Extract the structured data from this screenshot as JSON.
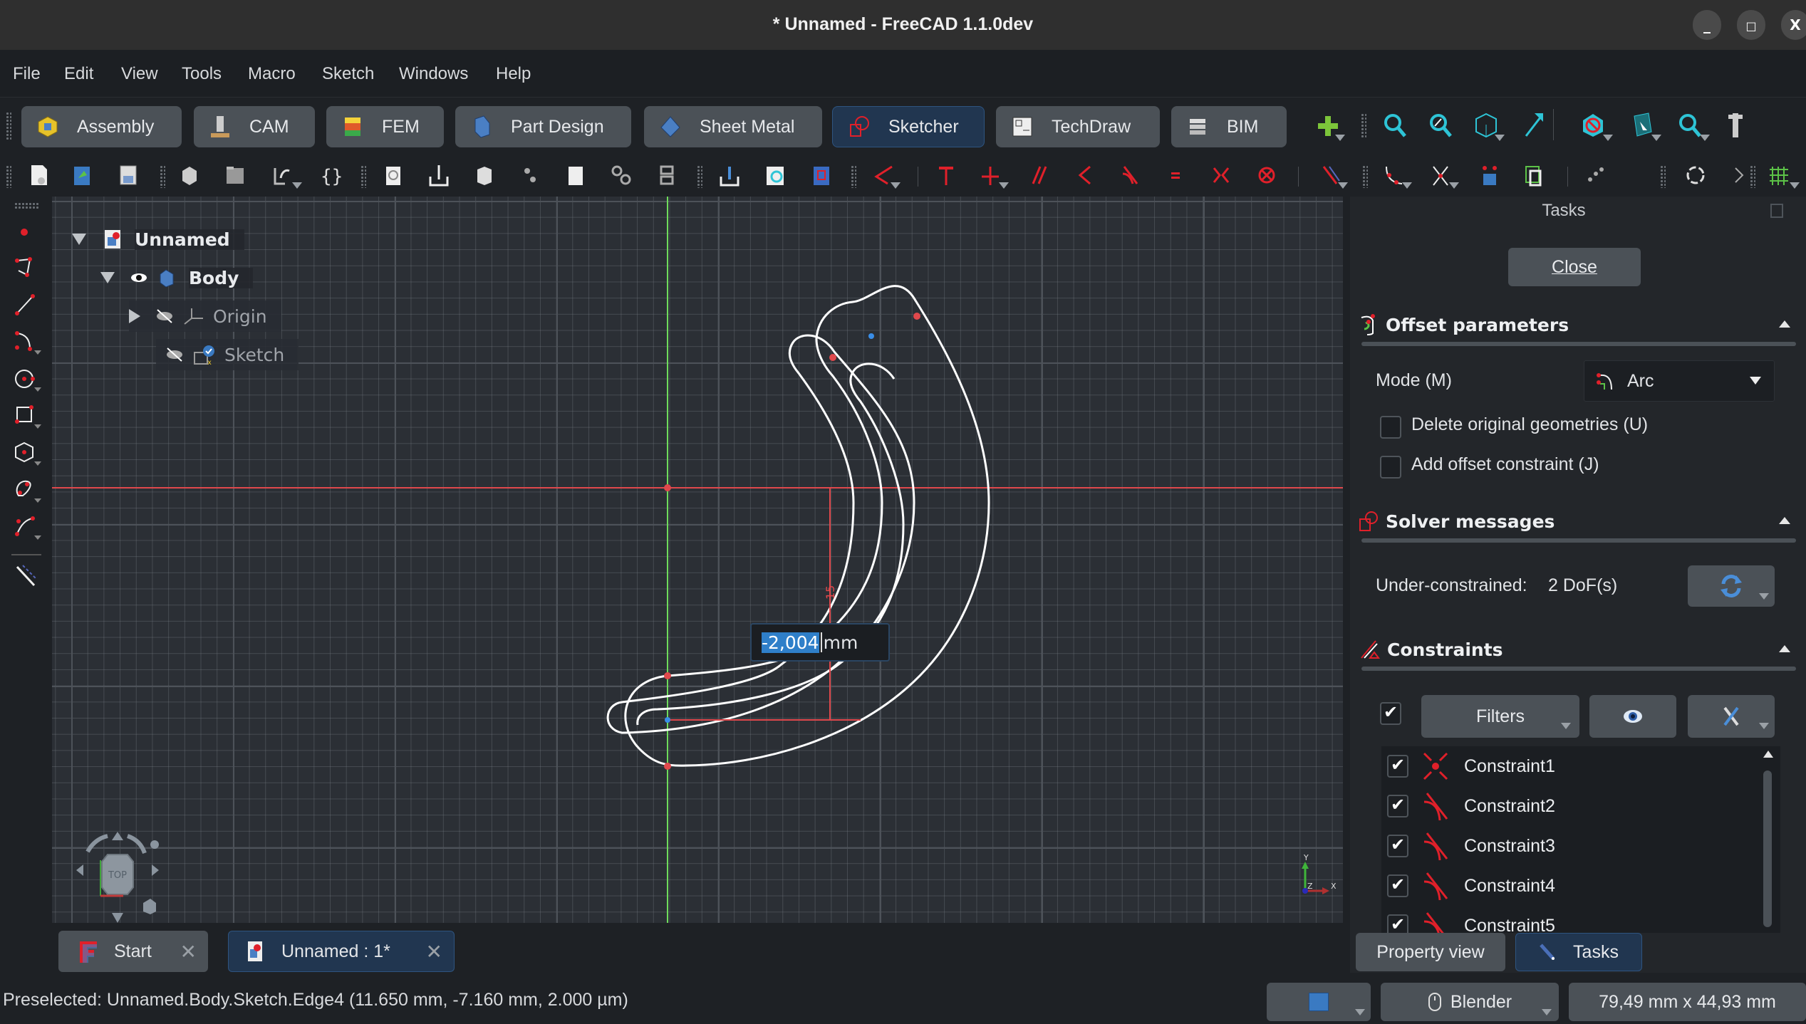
{
  "window": {
    "title": "* Unnamed - FreeCAD 1.1.0dev",
    "controls": {
      "minimize": "_",
      "maximize": "□",
      "close": "X"
    }
  },
  "menu": [
    {
      "label": "File",
      "mnemonic": "F"
    },
    {
      "label": "Edit",
      "mnemonic": "E"
    },
    {
      "label": "View",
      "mnemonic": "V"
    },
    {
      "label": "Tools",
      "mnemonic": "T"
    },
    {
      "label": "Macro",
      "mnemonic": "M"
    },
    {
      "label": "Sketch",
      "mnemonic": "S"
    },
    {
      "label": "Windows",
      "mnemonic": "W"
    },
    {
      "label": "Help",
      "mnemonic": "H"
    }
  ],
  "workbenches": [
    {
      "label": "Assembly",
      "icon": "assembly-icon",
      "active": false
    },
    {
      "label": "CAM",
      "icon": "cam-icon",
      "active": false
    },
    {
      "label": "FEM",
      "icon": "fem-icon",
      "active": false
    },
    {
      "label": "Part Design",
      "icon": "part-design-icon",
      "active": false
    },
    {
      "label": "Sheet Metal",
      "icon": "sheet-metal-icon",
      "active": false
    },
    {
      "label": "Sketcher",
      "icon": "sketcher-icon",
      "active": true
    },
    {
      "label": "TechDraw",
      "icon": "techdraw-icon",
      "active": false
    },
    {
      "label": "BIM",
      "icon": "bim-icon",
      "active": false
    }
  ],
  "tree": {
    "root": "Unnamed",
    "body": "Body",
    "origin": "Origin",
    "sketch": "Sketch"
  },
  "canvas": {
    "offset_input_value": "-2,004",
    "offset_input_unit": "mm",
    "dimension_label": "15",
    "navcube_face": "TOP",
    "axis_labels": {
      "x": "X",
      "y": "Y",
      "z": "Z"
    }
  },
  "tasks": {
    "title": "Tasks",
    "close_label": "Close",
    "offset_parameters": {
      "heading": "Offset parameters",
      "mode_label": "Mode (M)",
      "mode_value": "Arc",
      "delete_original_label": "Delete original geometries (U)",
      "delete_original_checked": false,
      "add_constraint_label": "Add offset constraint (J)",
      "add_constraint_checked": false
    },
    "solver": {
      "heading": "Solver messages",
      "status_label": "Under-constrained:",
      "status_value": "2 DoF(s)"
    },
    "constraints": {
      "heading": "Constraints",
      "filters_label": "Filters",
      "select_all_checked": true,
      "items": [
        {
          "name": "Constraint1",
          "type": "coincident",
          "checked": true
        },
        {
          "name": "Constraint2",
          "type": "tangent",
          "checked": true
        },
        {
          "name": "Constraint3",
          "type": "tangent",
          "checked": true
        },
        {
          "name": "Constraint4",
          "type": "tangent",
          "checked": true
        },
        {
          "name": "Constraint5",
          "type": "tangent",
          "checked": true
        }
      ]
    }
  },
  "panel_tabs": [
    {
      "label": "Property view",
      "active": false
    },
    {
      "label": "Tasks",
      "active": true
    }
  ],
  "doc_tabs": [
    {
      "label": "Start",
      "active": false
    },
    {
      "label": "Unnamed : 1*",
      "active": true
    }
  ],
  "status": {
    "message": "Preselected: Unnamed.Body.Sketch.Edge4 (11.650 mm, -7.160 mm, 2.000 µm)",
    "navigation_style": "Blender",
    "dimensions": "79,49 mm x 44,93 mm"
  },
  "colors": {
    "accent": "#2f7fc9",
    "active_tab_bg": "#213650",
    "sketch_red": "#e0363a",
    "axis_green": "#6fdc5c"
  }
}
